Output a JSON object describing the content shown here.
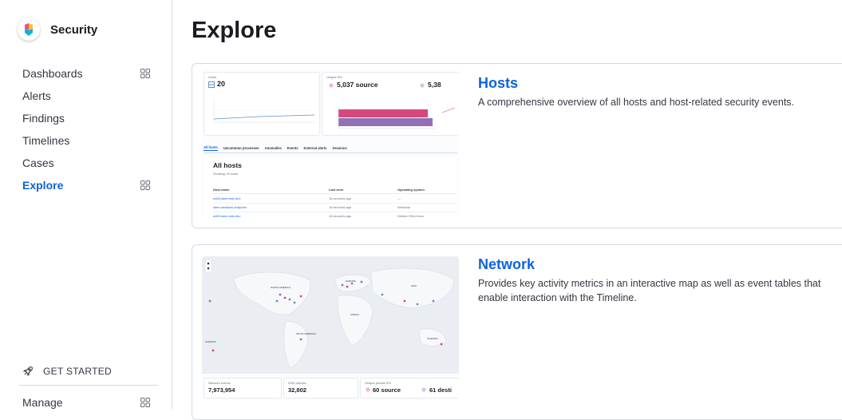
{
  "app": {
    "title": "Security"
  },
  "sidebar": {
    "items": [
      {
        "label": "Dashboards",
        "has_grid_icon": true
      },
      {
        "label": "Alerts",
        "has_grid_icon": false
      },
      {
        "label": "Findings",
        "has_grid_icon": false
      },
      {
        "label": "Timelines",
        "has_grid_icon": false
      },
      {
        "label": "Cases",
        "has_grid_icon": false
      },
      {
        "label": "Explore",
        "has_grid_icon": true,
        "active": true
      }
    ],
    "get_started": "GET STARTED",
    "manage": "Manage"
  },
  "page": {
    "title": "Explore"
  },
  "cards": {
    "hosts": {
      "title": "Hosts",
      "description": "A comprehensive overview of all hosts and host-related security events.",
      "preview": {
        "hosts_label": "Hosts",
        "hosts_count": "20",
        "unique_ips_label": "Unique IPs",
        "source_count": "5,037 source",
        "dest_count": "5,38",
        "tabs": [
          "All hosts",
          "Uncommon processes",
          "Anomalies",
          "Events",
          "External alerts",
          "Sessions"
        ],
        "table_title": "All hosts",
        "table_subtitle": "Showing: 20 hosts",
        "columns": [
          "Host name",
          "Last seen",
          "Operating system"
        ],
        "rows": [
          [
            "ed03.siem.estc.dev",
            "18 seconds ago",
            "—"
          ],
          [
            "siem-windows-endpoint",
            "18 seconds ago",
            "Windows"
          ],
          [
            "ed03.siem.estc.dev",
            "18 seconds ago",
            "Debian GNU/Linux"
          ]
        ]
      }
    },
    "network": {
      "title": "Network",
      "description": "Provides key activity metrics in an interactive map as well as event tables that enable interaction with the Timeline.",
      "preview": {
        "map_labels": [
          "NORTH AMERICA",
          "EUROPE",
          "ASIA",
          "AFRICA",
          "SOUTH AMERICA",
          "OCEANIA",
          "OCEANIA"
        ],
        "stats": [
          {
            "label": "Network events",
            "value": "7,973,954"
          },
          {
            "label": "DNS queries",
            "value": "32,802"
          },
          {
            "label": "Unique private IPs",
            "value": "60 source"
          },
          {
            "label": "",
            "value": "61 desti"
          }
        ]
      }
    }
  },
  "colors": {
    "accent": "#0b64dd",
    "pink": "#d6487b",
    "purple": "#9170b8"
  }
}
